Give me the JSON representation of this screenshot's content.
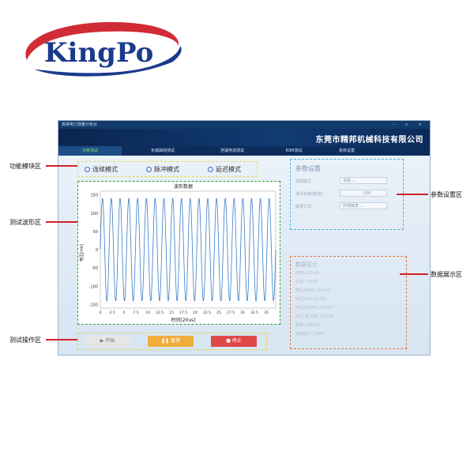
{
  "logo": {
    "text": "KingPo"
  },
  "window": {
    "title": "高频电刀测量分析仪",
    "window_controls": "– ▫ ×",
    "company": "东莞市精邦机械科技有限公司",
    "tabs": [
      {
        "label": "功率测试",
        "active": true
      },
      {
        "label": "负载曲线测试",
        "active": false
      },
      {
        "label": "泄漏电流测试",
        "active": false
      },
      {
        "label": "RSM测试",
        "active": false
      },
      {
        "label": "系统设置",
        "active": false
      }
    ]
  },
  "modes": [
    {
      "label": "连续模式"
    },
    {
      "label": "脉冲模式"
    },
    {
      "label": "延迟模式"
    }
  ],
  "chart_data": {
    "type": "line",
    "title": "波形数据",
    "xlabel": "时间[20us]",
    "ylabel": "电压[mV]",
    "x_ticks": [
      "0",
      "2.5",
      "5",
      "7.5",
      "10",
      "12.5",
      "15",
      "17.5",
      "20",
      "22.5",
      "25",
      "27.5",
      "30",
      "32.5",
      "35"
    ],
    "y_ticks": [
      "150",
      "100",
      "50",
      "0",
      "-50",
      "-100",
      "-150"
    ],
    "ylim": [
      -160,
      160
    ],
    "xlim": [
      0,
      37
    ],
    "series": [
      {
        "amplitude": 140,
        "cycles": 20
      }
    ],
    "line_color": "#3a7cc9"
  },
  "operation": {
    "start_label": "▶ 开始",
    "pause_label": "❚❚ 暂停",
    "stop_label": "■ 停止",
    "start_color": "#e6e6e6",
    "pause_color": "#f0ad3c",
    "stop_color": "#e04848"
  },
  "params": {
    "title": "参数设置",
    "rows": [
      {
        "label": "测试模式：",
        "value": "单极 ⌄"
      },
      {
        "label": "测试负载(欧姆)：",
        "value": "100"
      },
      {
        "label": "触发方式：",
        "value": "外部触发 ⌄"
      }
    ]
  },
  "data_display": {
    "title": "数据显示",
    "lines": [
      "电流:102mA",
      "功率:1.05W",
      "电压(RMS):10.54V",
      "电压(PK):13.20V",
      "电压(PK-PK):13.20V",
      "电压(最大值):13.20V",
      "频率:200KHz",
      "波峰因子:1.466"
    ]
  },
  "callouts": {
    "function_module": "功能模块区",
    "waveform": "测试波形区",
    "operation": "测试操作区",
    "params": "参数设置区",
    "data": "数据展示区"
  },
  "colors": {
    "logo_red": "#d12b35",
    "logo_blue": "#1b3a8c",
    "callout_line": "#d4202a"
  }
}
